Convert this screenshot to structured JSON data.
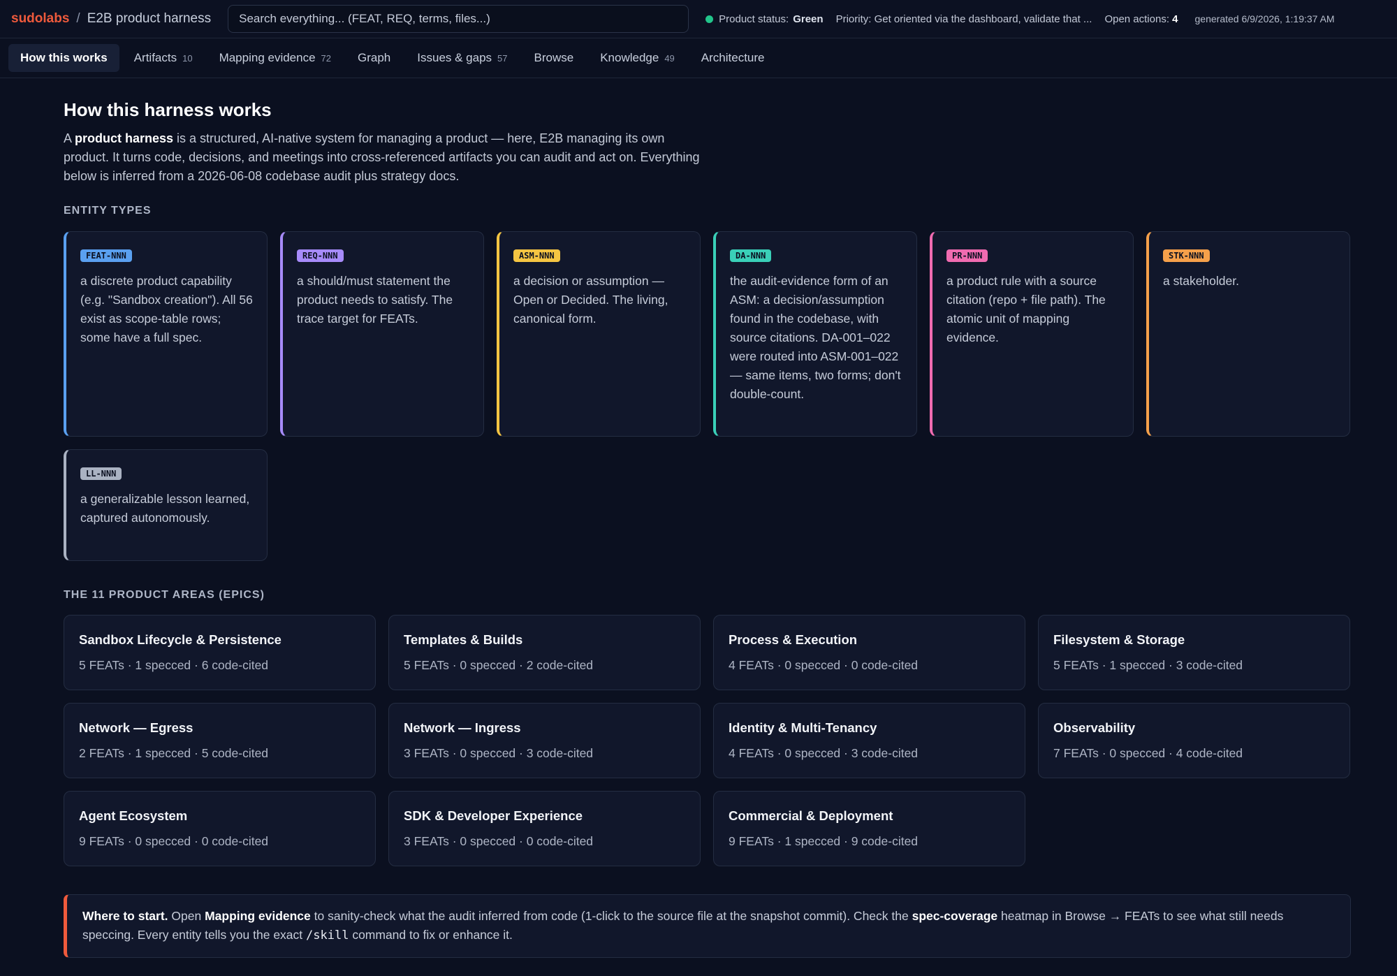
{
  "header": {
    "brand": "sudolabs",
    "separator": "/",
    "title": "E2B product harness",
    "search_placeholder": "Search everything...  (FEAT, REQ, terms, files...)",
    "status_label": "Product status:",
    "status_value": "Green",
    "status_color": "#22c58b",
    "priority": "Priority: Get oriented via the dashboard, validate that ...",
    "open_actions_label": "Open actions:",
    "open_actions_value": "4",
    "generated": "generated 6/9/2026, 1:19:37 AM"
  },
  "tabs": [
    {
      "label": "How this works",
      "count": "",
      "active": true
    },
    {
      "label": "Artifacts",
      "count": "10"
    },
    {
      "label": "Mapping evidence",
      "count": "72"
    },
    {
      "label": "Graph",
      "count": ""
    },
    {
      "label": "Issues & gaps",
      "count": "57"
    },
    {
      "label": "Browse",
      "count": ""
    },
    {
      "label": "Knowledge",
      "count": "49"
    },
    {
      "label": "Architecture",
      "count": ""
    }
  ],
  "main": {
    "title": "How this harness works",
    "intro": {
      "p1": "A ",
      "bold": "product harness",
      "p2": " is a structured, AI-native system for managing a product — here, E2B managing its own product. It turns code, decisions, and meetings into cross-referenced artifacts you can audit and act on. Everything below is inferred from a 2026-06-08 codebase audit plus strategy docs."
    },
    "entity_types_label": "ENTITY TYPES",
    "entity_types": [
      {
        "badge": "FEAT-NNN",
        "color": "#5aa0f0",
        "desc": "a discrete product capability (e.g. \"Sandbox creation\"). All 56 exist as scope-table rows; some have a full spec."
      },
      {
        "badge": "REQ-NNN",
        "color": "#a78bfa",
        "desc": "a should/must statement the product needs to satisfy. The trace target for FEATs."
      },
      {
        "badge": "ASM-NNN",
        "color": "#f5c542",
        "desc": "a decision or assumption — Open or Decided. The living, canonical form."
      },
      {
        "badge": "DA-NNN",
        "color": "#3ad0b8",
        "desc": "the audit-evidence form of an ASM: a decision/assumption found in the codebase, with source citations. DA-001–022 were routed into ASM-001–022 — same items, two forms; don't double-count."
      },
      {
        "badge": "PR-NNN",
        "color": "#f06bb0",
        "desc": "a product rule with a source citation (repo + file path). The atomic unit of mapping evidence."
      },
      {
        "badge": "STK-NNN",
        "color": "#f5a04a",
        "desc": "a stakeholder."
      },
      {
        "badge": "LL-NNN",
        "color": "#aab2c2",
        "desc": "a generalizable lesson learned, captured autonomously."
      }
    ],
    "areas_label": "THE 11 PRODUCT AREAS (EPICS)",
    "areas": [
      {
        "title": "Sandbox Lifecycle & Persistence",
        "stats": "5 FEATs · 1 specced · 6 code-cited"
      },
      {
        "title": "Templates & Builds",
        "stats": "5 FEATs · 0 specced · 2 code-cited"
      },
      {
        "title": "Process & Execution",
        "stats": "4 FEATs · 0 specced · 0 code-cited"
      },
      {
        "title": "Filesystem & Storage",
        "stats": "5 FEATs · 1 specced · 3 code-cited"
      },
      {
        "title": "Network — Egress",
        "stats": "2 FEATs · 1 specced · 5 code-cited"
      },
      {
        "title": "Network — Ingress",
        "stats": "3 FEATs · 0 specced · 3 code-cited"
      },
      {
        "title": "Identity & Multi-Tenancy",
        "stats": "4 FEATs · 0 specced · 3 code-cited"
      },
      {
        "title": "Observability",
        "stats": "7 FEATs · 0 specced · 4 code-cited"
      },
      {
        "title": "Agent Ecosystem",
        "stats": "9 FEATs · 0 specced · 0 code-cited"
      },
      {
        "title": "SDK & Developer Experience",
        "stats": "3 FEATs · 0 specced · 0 code-cited"
      },
      {
        "title": "Commercial & Deployment",
        "stats": "9 FEATs · 1 specced · 9 code-cited"
      }
    ],
    "callout": {
      "lead": "Where to start.",
      "t1": " Open ",
      "b1": "Mapping evidence",
      "t2": " to sanity-check what the audit inferred from code (1-click to the source file at the snapshot commit). Check the ",
      "b2": "spec-coverage",
      "t3": " heatmap in Browse → FEATs to see what still needs speccing. Every entity tells you the exact ",
      "code": "/skill",
      "t4": " command to fix or enhance it.",
      "accent": "#ef5a3c"
    }
  }
}
